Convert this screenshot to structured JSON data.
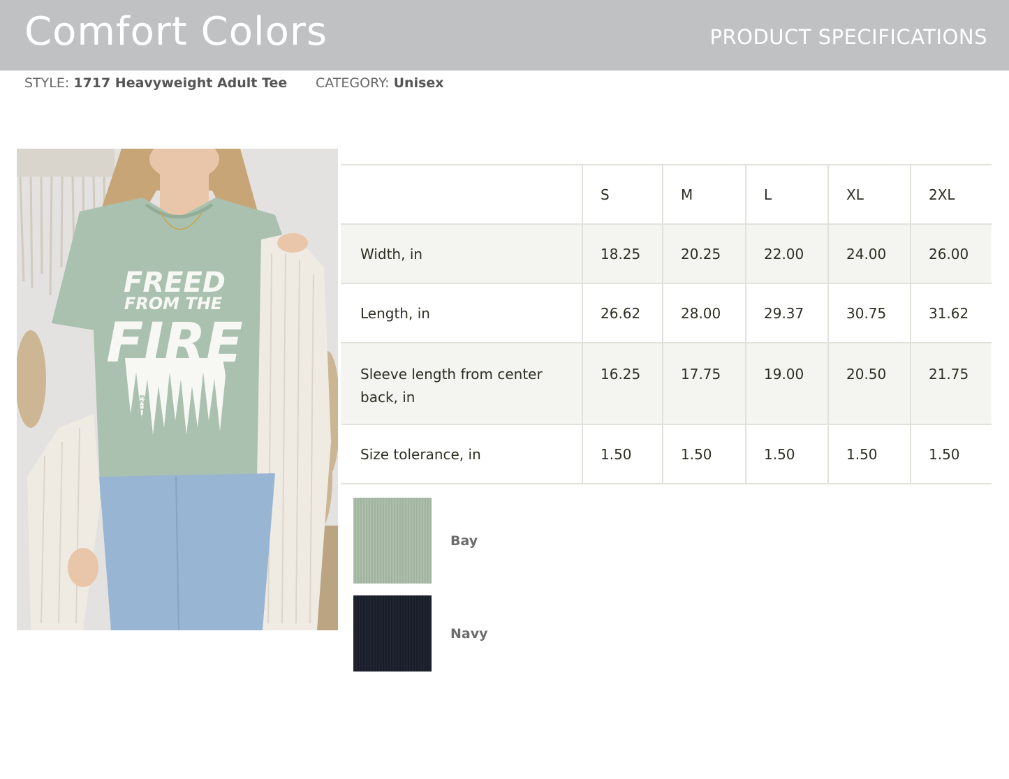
{
  "header": {
    "brand": "Comfort Colors",
    "doc_type": "PRODUCT SPECIFICATIONS",
    "background_color": "#c0c1c3"
  },
  "meta": {
    "style_label": "STYLE:",
    "style_value": "1717 Heavyweight Adult Tee",
    "category_label": "CATEGORY:",
    "category_value": "Unisex"
  },
  "photo": {
    "shirt_print": [
      "FREED",
      "FROM THE",
      "FIRE"
    ],
    "shirt_print_side": "JUDE 1:23"
  },
  "size_table": {
    "sizes": [
      "S",
      "M",
      "L",
      "XL",
      "2XL"
    ],
    "rows": [
      {
        "label": "Width, in",
        "values": [
          "18.25",
          "20.25",
          "22.00",
          "24.00",
          "26.00"
        ]
      },
      {
        "label": "Length, in",
        "values": [
          "26.62",
          "28.00",
          "29.37",
          "30.75",
          "31.62"
        ]
      },
      {
        "label": "Sleeve length from center back, in",
        "values": [
          "16.25",
          "17.75",
          "19.00",
          "20.50",
          "21.75"
        ]
      },
      {
        "label": "Size tolerance, in",
        "values": [
          "1.50",
          "1.50",
          "1.50",
          "1.50",
          "1.50"
        ]
      }
    ]
  },
  "colors": [
    {
      "name": "Bay",
      "hex": "#a8bba7"
    },
    {
      "name": "Navy",
      "hex": "#1a1e2b"
    }
  ]
}
